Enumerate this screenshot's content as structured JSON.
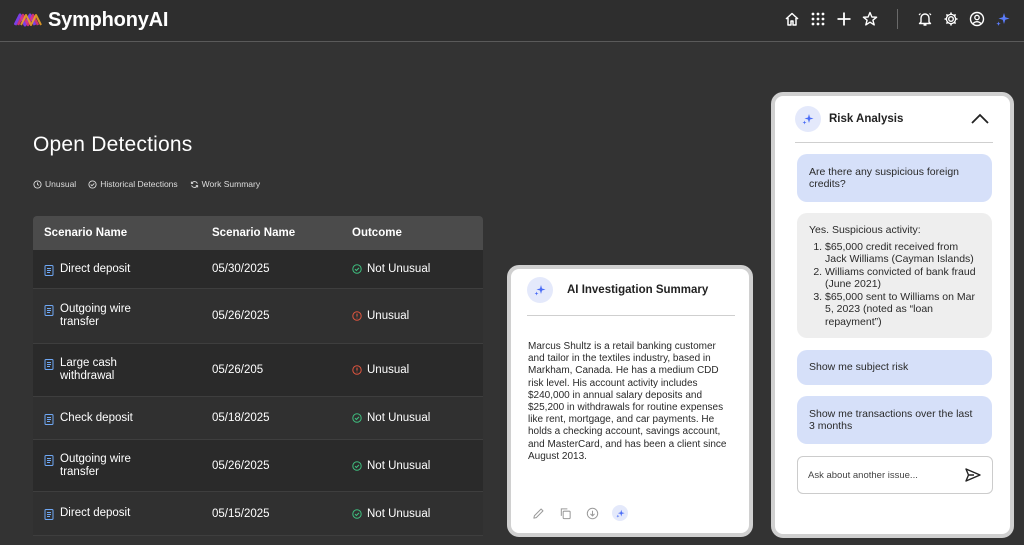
{
  "app": {
    "brand": "SymphonyAI"
  },
  "topbar": {
    "icons": [
      "home-icon",
      "apps-grid-icon",
      "plus-icon",
      "star-icon",
      "bell-icon",
      "gear-icon",
      "user-icon",
      "sparkle-icon"
    ]
  },
  "page": {
    "title": "Open Detections",
    "filters": [
      {
        "label": "Unusual",
        "icon": "clock-icon"
      },
      {
        "label": "Historical Detections",
        "icon": "check-circle-icon"
      },
      {
        "label": "Work Summary",
        "icon": "refresh-icon"
      }
    ]
  },
  "table": {
    "headers": [
      "Scenario Name",
      "Scenario Name",
      "Outcome"
    ],
    "rows": [
      {
        "scenario": "Direct deposit",
        "date": "05/30/2025",
        "outcome": "Not Unusual",
        "status": "ok"
      },
      {
        "scenario": "Outgoing wire transfer",
        "date": "05/26/2025",
        "outcome": "Unusual",
        "status": "warn"
      },
      {
        "scenario": "Large cash withdrawal",
        "date": "05/26/205",
        "outcome": "Unusual",
        "status": "warn"
      },
      {
        "scenario": "Check deposit",
        "date": "05/18/2025",
        "outcome": "Not Unusual",
        "status": "ok"
      },
      {
        "scenario": "Outgoing wire transfer",
        "date": "05/26/2025",
        "outcome": "Not Unusual",
        "status": "ok"
      },
      {
        "scenario": "Direct deposit",
        "date": "05/15/2025",
        "outcome": "Not Unusual",
        "status": "ok"
      }
    ]
  },
  "ai_summary": {
    "title": "AI Investigation Summary",
    "body": "Marcus Shultz is a retail banking customer and tailor in the textiles industry, based in Markham, Canada. He has a medium CDD risk level. His account activity includes $240,000 in annual salary deposits and $25,200 in withdrawals for routine expenses like rent, mortgage, and car payments. He holds a checking account, savings account, and MasterCard, and has been a client since August 2013.",
    "actions": [
      "pencil-icon",
      "copy-icon",
      "download-icon",
      "sparkle-icon"
    ]
  },
  "risk": {
    "title": "Risk Analysis",
    "q1": "Are there any suspicious foreign credits?",
    "answer_intro": "Yes. Suspicious activity:",
    "answer_items": [
      "$65,000 credit received from Jack Williams (Cayman Islands)",
      "Williams convicted of bank fraud (June 2021)",
      "$65,000 sent to Williams on Mar 5, 2023 (noted as “loan repayment”)"
    ],
    "q2": "Show me subject risk",
    "q3": "Show me transactions over the last 3 months",
    "input_placeholder": "Ask about another issue..."
  },
  "colors": {
    "background": "#333333",
    "table_header": "#4b4b4b",
    "ok": "#3fbf7f",
    "warn": "#e0553f",
    "accent": "#4a6cf7",
    "user_bubble": "#d6e0f9"
  }
}
